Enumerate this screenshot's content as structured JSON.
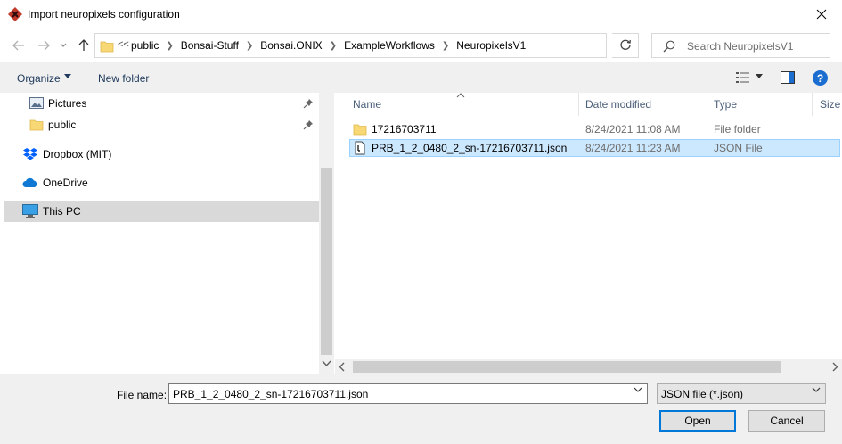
{
  "window": {
    "title": "Import neuropixels configuration"
  },
  "address": {
    "overflow": "<<",
    "crumbs": [
      "public",
      "Bonsai-Stuff",
      "Bonsai.ONIX",
      "ExampleWorkflows",
      "NeuropixelsV1"
    ]
  },
  "search": {
    "placeholder": "Search NeuropixelsV1"
  },
  "toolbar": {
    "organize": "Organize",
    "new_folder": "New folder",
    "help": "?"
  },
  "nav": {
    "items": [
      {
        "label": "Pictures",
        "icon": "pictures-icon",
        "pinned": true
      },
      {
        "label": "public",
        "icon": "folder-icon",
        "pinned": true
      },
      {
        "label": "Dropbox (MIT)",
        "icon": "dropbox-icon"
      },
      {
        "label": "OneDrive",
        "icon": "onedrive-icon"
      },
      {
        "label": "This PC",
        "icon": "this-pc-icon",
        "selected": true
      }
    ]
  },
  "columns": [
    "Name",
    "Date modified",
    "Type",
    "Size"
  ],
  "files": [
    {
      "name": "17216703711",
      "date": "8/24/2021 11:08 AM",
      "type": "File folder",
      "icon": "folder-icon"
    },
    {
      "name": "PRB_1_2_0480_2_sn-17216703711.json",
      "date": "8/24/2021 11:23 AM",
      "type": "JSON File",
      "icon": "json-file-icon",
      "selected": true
    }
  ],
  "footer": {
    "filename_label": "File name:",
    "filename_value": "PRB_1_2_0480_2_sn-17216703711.json",
    "filetype": "JSON file (*.json)",
    "open": "Open",
    "cancel": "Cancel"
  },
  "colors": {
    "selection": "#cce8ff",
    "selection_border": "#99d1ff",
    "accent": "#0078d7",
    "help": "#1c6dd0"
  }
}
